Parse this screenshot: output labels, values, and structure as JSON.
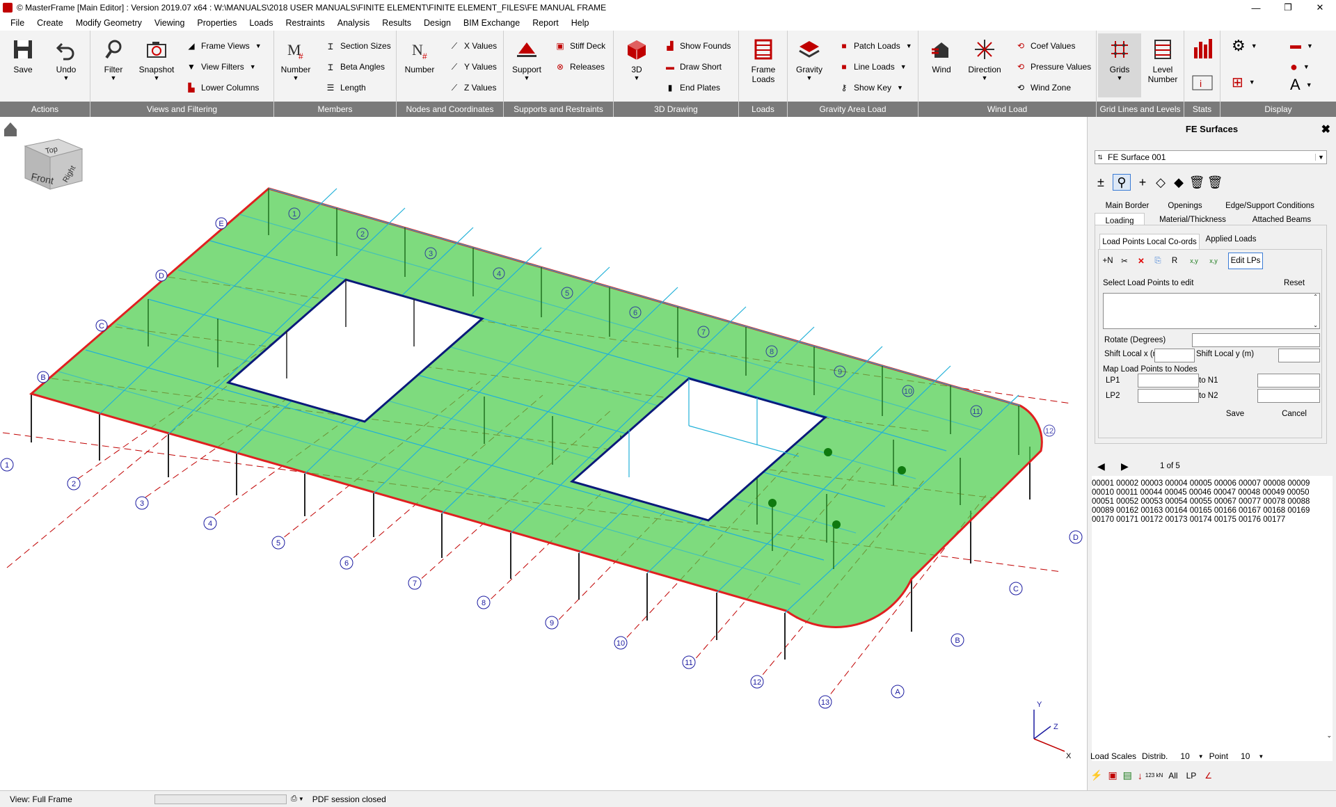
{
  "window": {
    "title": "© MasterFrame [Main Editor] : Version 2019.07 x64 : W:\\MANUALS\\2018 USER MANUALS\\FINITE ELEMENT\\FINITE ELEMENT_FILES\\FE MANUAL FRAME",
    "minimize": "—",
    "maximize": "❐",
    "close": "✕"
  },
  "menu": [
    "File",
    "Create",
    "Modify Geometry",
    "Viewing",
    "Properties",
    "Loads",
    "Restraints",
    "Analysis",
    "Results",
    "Design",
    "BIM Exchange",
    "Report",
    "Help"
  ],
  "ribbon": {
    "actions": {
      "caption": "Actions",
      "save": "Save",
      "undo": "Undo"
    },
    "views": {
      "caption": "Views and Filtering",
      "filter": "Filter",
      "snapshot": "Snapshot",
      "frame_views": "Frame Views",
      "view_filters": "View Filters",
      "lower_columns": "Lower Columns"
    },
    "members": {
      "caption": "Members",
      "number": "Number",
      "section_sizes": "Section Sizes",
      "beta_angles": "Beta Angles",
      "length": "Length"
    },
    "nodes": {
      "caption": "Nodes and Coordinates",
      "number": "Number",
      "x_values": "X Values",
      "y_values": "Y Values",
      "z_values": "Z Values"
    },
    "supports": {
      "caption": "Supports and Restraints",
      "support": "Support",
      "stiff_deck": "Stiff Deck",
      "releases": "Releases"
    },
    "drawing3d": {
      "caption": "3D Drawing",
      "three_d": "3D",
      "show_founds": "Show Founds",
      "draw_short": "Draw Short",
      "end_plates": "End Plates"
    },
    "loads": {
      "caption": "Loads",
      "frame_loads": "Frame Loads"
    },
    "gravity": {
      "caption": "Gravity Area Load",
      "gravity": "Gravity",
      "patch_loads": "Patch Loads",
      "line_loads": "Line Loads",
      "show_key": "Show Key"
    },
    "wind": {
      "caption": "Wind Load",
      "wind": "Wind",
      "direction": "Direction",
      "coef_values": "Coef Values",
      "pressure_values": "Pressure Values",
      "wind_zone": "Wind Zone"
    },
    "grids": {
      "caption": "Grid Lines and Levels",
      "grids": "Grids",
      "level_number": "Level Number"
    },
    "stats": {
      "caption": "Stats"
    },
    "display": {
      "caption": "Display"
    }
  },
  "viewcube": {
    "top": "Top",
    "front": "Front",
    "right": "Right"
  },
  "gridlabels": {
    "front": [
      "1",
      "2",
      "3",
      "4",
      "5",
      "6",
      "7",
      "8",
      "9",
      "10",
      "11",
      "12",
      "13"
    ],
    "side": [
      "A",
      "B",
      "C",
      "D"
    ],
    "back_letters": [
      "E",
      "D",
      "C",
      "B"
    ],
    "back_numbers": [
      "1",
      "2",
      "3",
      "4",
      "5",
      "6",
      "7",
      "8",
      "9",
      "10",
      "11",
      "12"
    ]
  },
  "axes": {
    "x": "X",
    "y": "Y",
    "z": "Z"
  },
  "panel": {
    "title": "FE Surfaces",
    "close": "✖",
    "surface_select": "FE Surface 001",
    "tools": [
      "±",
      "⚲",
      "+",
      "◇",
      "◆",
      "🗑",
      "🗑"
    ],
    "tabs_row1": [
      "Main Border",
      "Openings",
      "Edge/Support Conditions"
    ],
    "tabs_row2": [
      "Loading",
      "Material/Thickness",
      "Attached Beams"
    ],
    "subtabs": [
      "Load Points Local Co-ords",
      "Applied Loads"
    ],
    "lp_tools": [
      "+N",
      "✂",
      "✕",
      "⎘",
      "R",
      "x,y",
      "x,y"
    ],
    "edit_lps": "Edit LPs",
    "select_lp_label": "Select Load Points to edit",
    "reset": "Reset",
    "rotate_label": "Rotate (Degrees)",
    "shift_x_label": "Shift Local x (m)",
    "shift_y_label": "Shift Local y (m)",
    "map_label": "Map Load Points to Nodes",
    "lp1": "LP1",
    "lp2": "LP2",
    "to_n1": "to N1",
    "to_n2": "to N2",
    "save": "Save",
    "cancel": "Cancel",
    "page_indicator": "1 of 5",
    "lp_list": "00001 00002 00003 00004 00005 00006 00007 00008 00009 00010 00011 00044 00045 00046 00047 00048 00049 00050 00051 00052 00053 00054 00055 00067 00077 00078 00088 00089 00162 00163 00164 00165 00166 00167 00168 00169 00170 00171 00172 00173 00174 00175 00176 00177",
    "load_scales": "Load Scales",
    "distrib_label": "Distrib.",
    "distrib_value": "10",
    "point_label": "Point",
    "point_value": "10",
    "bottom_tools": [
      "123 kN",
      "All",
      "LP"
    ]
  },
  "status": {
    "view": "View: Full Frame",
    "pdf": "PDF session closed"
  }
}
